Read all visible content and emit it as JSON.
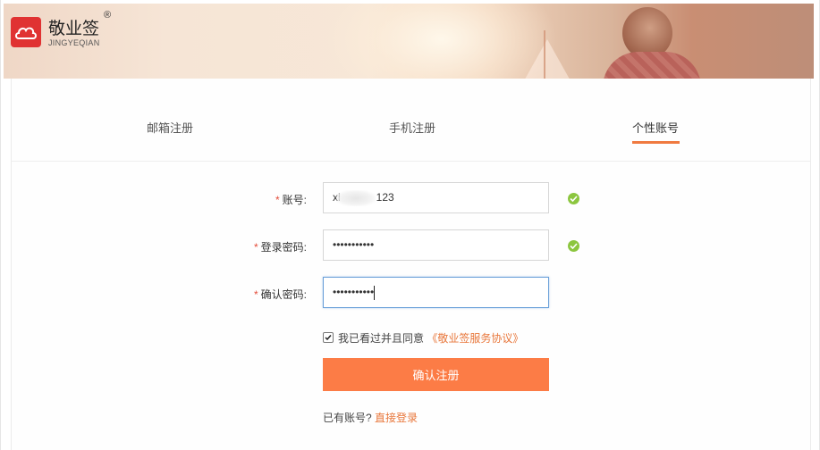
{
  "brand": {
    "name": "敬业签",
    "reg_mark": "®",
    "subtitle": "JINGYEQIAN",
    "color": "#e03232"
  },
  "tabs": [
    {
      "label": "邮箱注册",
      "active": false
    },
    {
      "label": "手机注册",
      "active": false
    },
    {
      "label": "个性账号",
      "active": true
    }
  ],
  "accent_color": "#fc7c46",
  "form": {
    "required_mark": "*",
    "account": {
      "label": "账号:",
      "value_start": "xi",
      "value_end": "123",
      "valid": true
    },
    "password": {
      "label": "登录密码:",
      "value": "•••••••••••",
      "valid": true
    },
    "confirm_password": {
      "label": "确认密码:",
      "value": "•••••••••••",
      "focused": true
    },
    "agreement": {
      "checked": true,
      "text": "我已看过并且同意",
      "link": "《敬业签服务协议》"
    },
    "submit_label": "确认注册",
    "login_prompt": "已有账号?",
    "login_link": "直接登录"
  }
}
